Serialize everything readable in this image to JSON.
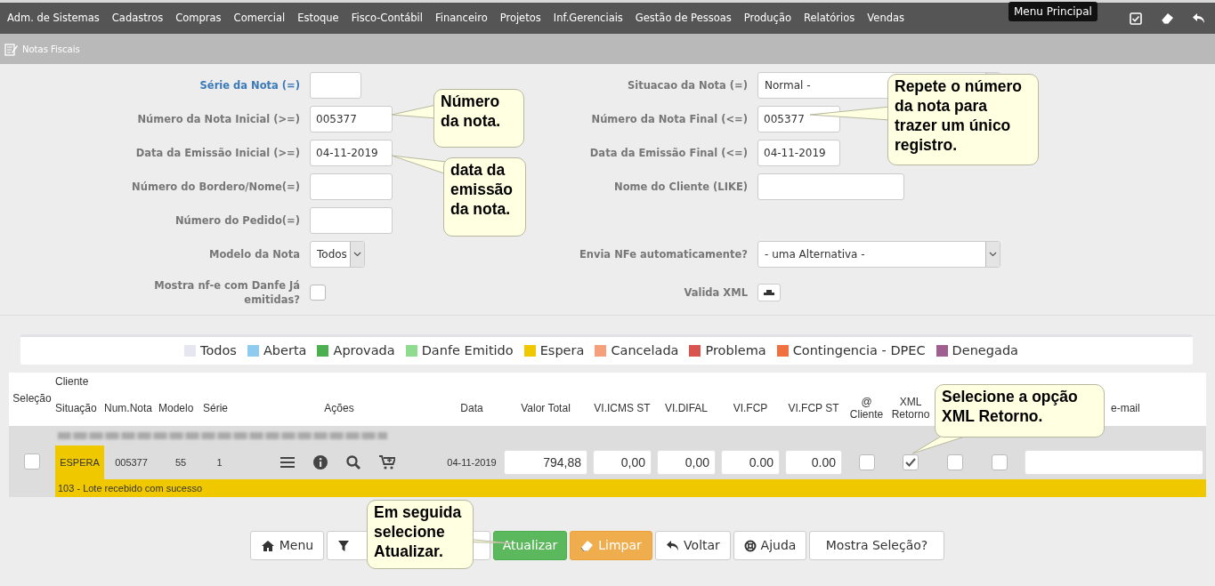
{
  "menu_bar": {
    "items": [
      "Adm. de Sistemas",
      "Cadastros",
      "Compras",
      "Comercial",
      "Estoque",
      "Fisco-Contábil",
      "Financeiro",
      "Projetos",
      "Inf.Gerenciais",
      "Gestão de Pessoas",
      "Produção",
      "Relatórios",
      "Vendas"
    ],
    "tooltip": "Menu Principal"
  },
  "breadcrumb": "Notas Fiscais",
  "form": {
    "left": [
      {
        "label": "Série da Nota (=)",
        "kind": "text",
        "highlighted": true
      },
      {
        "label": "Número da Nota Inicial (>=)",
        "kind": "text",
        "value": "005377",
        "highlighted": false
      },
      {
        "label": "Data da Emissão Inicial (>=)",
        "kind": "text",
        "value": "04-11-2019",
        "highlighted": false
      },
      {
        "label": "Número do Bordero/Nome(=)",
        "kind": "text",
        "highlighted": false
      },
      {
        "label": "Número do Pedido(=)",
        "kind": "text",
        "highlighted": false
      },
      {
        "label": "Modelo da Nota",
        "kind": "select",
        "value": "Todos",
        "highlighted": false
      },
      {
        "label": "Mostra nf-e com Danfe Já emitidas?",
        "kind": "checkbox",
        "checked": false,
        "highlighted": false
      }
    ],
    "right": [
      {
        "label": "Situacao da Nota (=)",
        "kind": "select",
        "value": "Normal -",
        "highlighted": false
      },
      {
        "label": "Número da Nota Final (<=)",
        "kind": "text",
        "value": "005377",
        "highlighted": false
      },
      {
        "label": "Data da Emissão Final (<=)",
        "kind": "text",
        "value": "04-11-2019",
        "highlighted": false
      },
      {
        "label": "Nome do Cliente (LIKE)",
        "kind": "text",
        "highlighted": false
      },
      {
        "label": "Envia NFe automaticamente?",
        "kind": "select",
        "value": "- uma Alternativa -",
        "highlighted": false
      },
      {
        "label": "Valida XML",
        "kind": "button",
        "highlighted": false
      }
    ]
  },
  "legend": [
    {
      "label": "Todos",
      "color": "#e6e6f0"
    },
    {
      "label": "Aberta",
      "color": "#8ecbf0"
    },
    {
      "label": "Aprovada",
      "color": "#4caf50"
    },
    {
      "label": "Danfe Emitido",
      "color": "#8fdb8f"
    },
    {
      "label": "Espera",
      "color": "#f0c800"
    },
    {
      "label": "Cancelada",
      "color": "#f5a07a"
    },
    {
      "label": "Problema",
      "color": "#d9534f"
    },
    {
      "label": "Contingencia - DPEC",
      "color": "#f07040"
    },
    {
      "label": "Denegada",
      "color": "#a0608f"
    }
  ],
  "table": {
    "select_header": "Seleção",
    "client_header": "Cliente",
    "columns": [
      "Situação",
      "Num.Nota",
      "Modelo",
      "Série",
      "Ações",
      "Data",
      "Valor Total",
      "VI.ICMS ST",
      "VI.DIFAL",
      "VI.FCP",
      "VI.FCP ST",
      "@ Cliente",
      "XML Retorno",
      "e-mail"
    ],
    "rows": [
      {
        "selected": false,
        "status": "ESPERA",
        "color": "#f0c800",
        "num": "005377",
        "modelo": "55",
        "serie": "1",
        "data": "04-11-2019",
        "values": [
          "794,88",
          "0,00",
          "0,00",
          "0.00",
          "0.00"
        ],
        "flags": [
          {
            "checked": false
          },
          {
            "checked": true
          },
          {
            "checked": false
          },
          {
            "checked": false
          }
        ],
        "message": "103 - Lote recebido com sucesso"
      }
    ]
  },
  "buttons": [
    {
      "kind": "labeled",
      "label": "Menu"
    },
    {
      "kind": "icon"
    },
    {
      "kind": "labeled",
      "label": "Atualizar"
    },
    {
      "kind": "labeled",
      "label": "Limpar"
    },
    {
      "kind": "labeled",
      "label": "Voltar"
    },
    {
      "kind": "labeled",
      "label": "Ajuda"
    },
    {
      "kind": "labeled",
      "label": "Mostra Seleção?"
    }
  ],
  "callouts": [
    "Número da nota.",
    "data da emissão da nota.",
    "Repete o número da nota para trazer um único registro.",
    "Selecione a opção XML Retorno.",
    "Em seguida selecione Atualizar."
  ]
}
